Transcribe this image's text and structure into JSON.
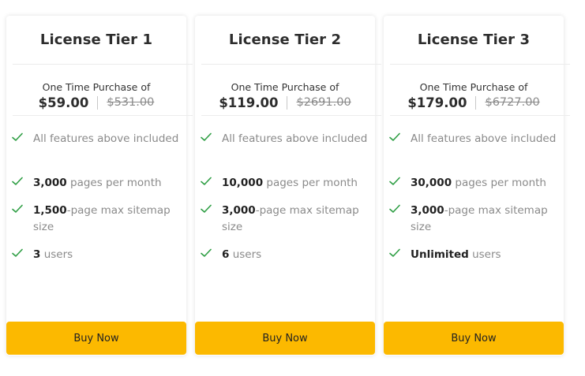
{
  "accent_color": "#fcb900",
  "check_color": "#2e9e44",
  "tiers": [
    {
      "title": "License Tier 1",
      "purchase_label": "One Time Purchase of",
      "price": "$59.00",
      "old_price": "$531.00",
      "features": [
        {
          "strong": "",
          "text": "All features above included",
          "icon": "check-icon"
        },
        {
          "strong": "3,000",
          "text": " pages per month",
          "icon": "check-icon"
        },
        {
          "strong": "1,500",
          "text": "-page max sitemap size",
          "icon": "check-icon"
        },
        {
          "strong": "3",
          "text": " users",
          "icon": "check-icon"
        }
      ],
      "button_label": "Buy Now"
    },
    {
      "title": "License Tier 2",
      "purchase_label": "One Time Purchase of",
      "price": "$119.00",
      "old_price": "$2691.00",
      "features": [
        {
          "strong": "",
          "text": "All features above included",
          "icon": "check-icon"
        },
        {
          "strong": "10,000",
          "text": " pages per month",
          "icon": "check-icon"
        },
        {
          "strong": "3,000",
          "text": "-page max sitemap size",
          "icon": "check-icon"
        },
        {
          "strong": "6",
          "text": " users",
          "icon": "check-icon"
        }
      ],
      "button_label": "Buy Now"
    },
    {
      "title": "License Tier 3",
      "purchase_label": "One Time Purchase of",
      "price": "$179.00",
      "old_price": "$6727.00",
      "features": [
        {
          "strong": "",
          "text": "All features above included",
          "icon": "check-icon"
        },
        {
          "strong": "30,000",
          "text": " pages per month",
          "icon": "check-icon"
        },
        {
          "strong": "3,000",
          "text": "-page max sitemap size",
          "icon": "check-icon"
        },
        {
          "strong": "Unlimited",
          "text": " users",
          "icon": "check-icon"
        }
      ],
      "button_label": "Buy Now"
    }
  ]
}
